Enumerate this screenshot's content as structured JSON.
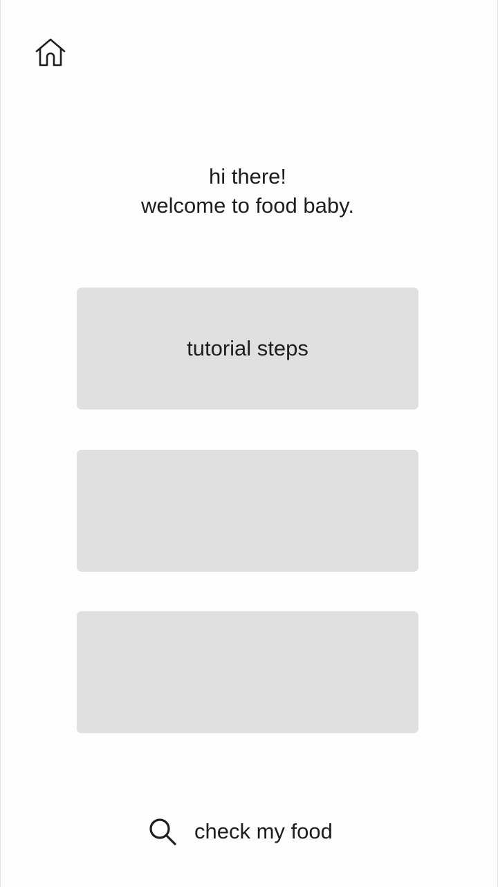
{
  "header": {
    "home_icon": "home-icon"
  },
  "greeting": {
    "line1": "hi there!",
    "line2": "welcome to food baby."
  },
  "cards": [
    {
      "label": "tutorial steps"
    },
    {
      "label": ""
    },
    {
      "label": ""
    }
  ],
  "bottom_action": {
    "icon": "search-icon",
    "label": "check my food"
  },
  "colors": {
    "background": "#fdfdfd",
    "card": "#e0e0e0",
    "text": "#1e1e1e"
  }
}
